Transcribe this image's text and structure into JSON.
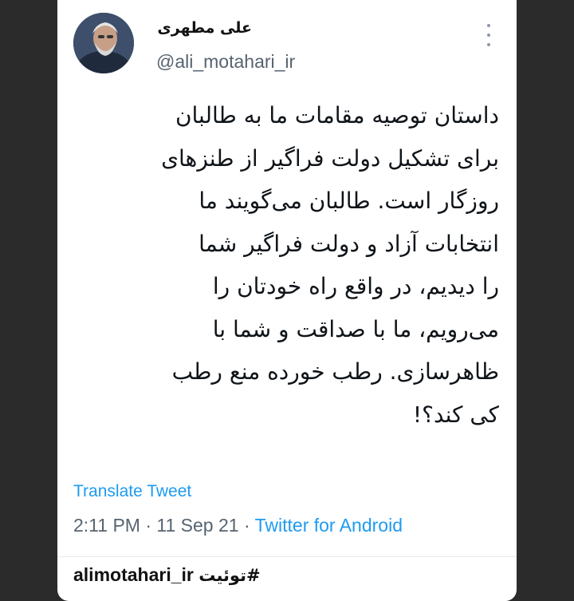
{
  "tweet": {
    "display_name": "علی مطهری",
    "handle": "@ali_motahari_ir",
    "text_lines": [
      "داستان توصیه مقامات ما به طالبان",
      "برای تشکیل دولت فراگیر از طنزهای",
      "روزگار است. طالبان می‌گویند ما",
      "انتخابات آزاد و دولت فراگیر شما",
      "را دیدیم، در واقع راه خودتان را",
      "می‌رویم، ما با صداقت و شما با",
      "ظاهرسازی. رطب خورده منع رطب",
      "کی کند؟!"
    ],
    "translate_label": "Translate Tweet",
    "time": "2:11 PM",
    "date": "11 Sep 21",
    "source": "Twitter for Android",
    "separator": "·"
  },
  "footer": {
    "account": "alimotahari_ir",
    "hashtag": "#توئیت"
  },
  "icons": {
    "more": "more-vertical-icon",
    "avatar": "avatar-photo"
  },
  "colors": {
    "background": "#2b2b2b",
    "card": "#ffffff",
    "link": "#1d9bf0",
    "muted": "#566370"
  }
}
